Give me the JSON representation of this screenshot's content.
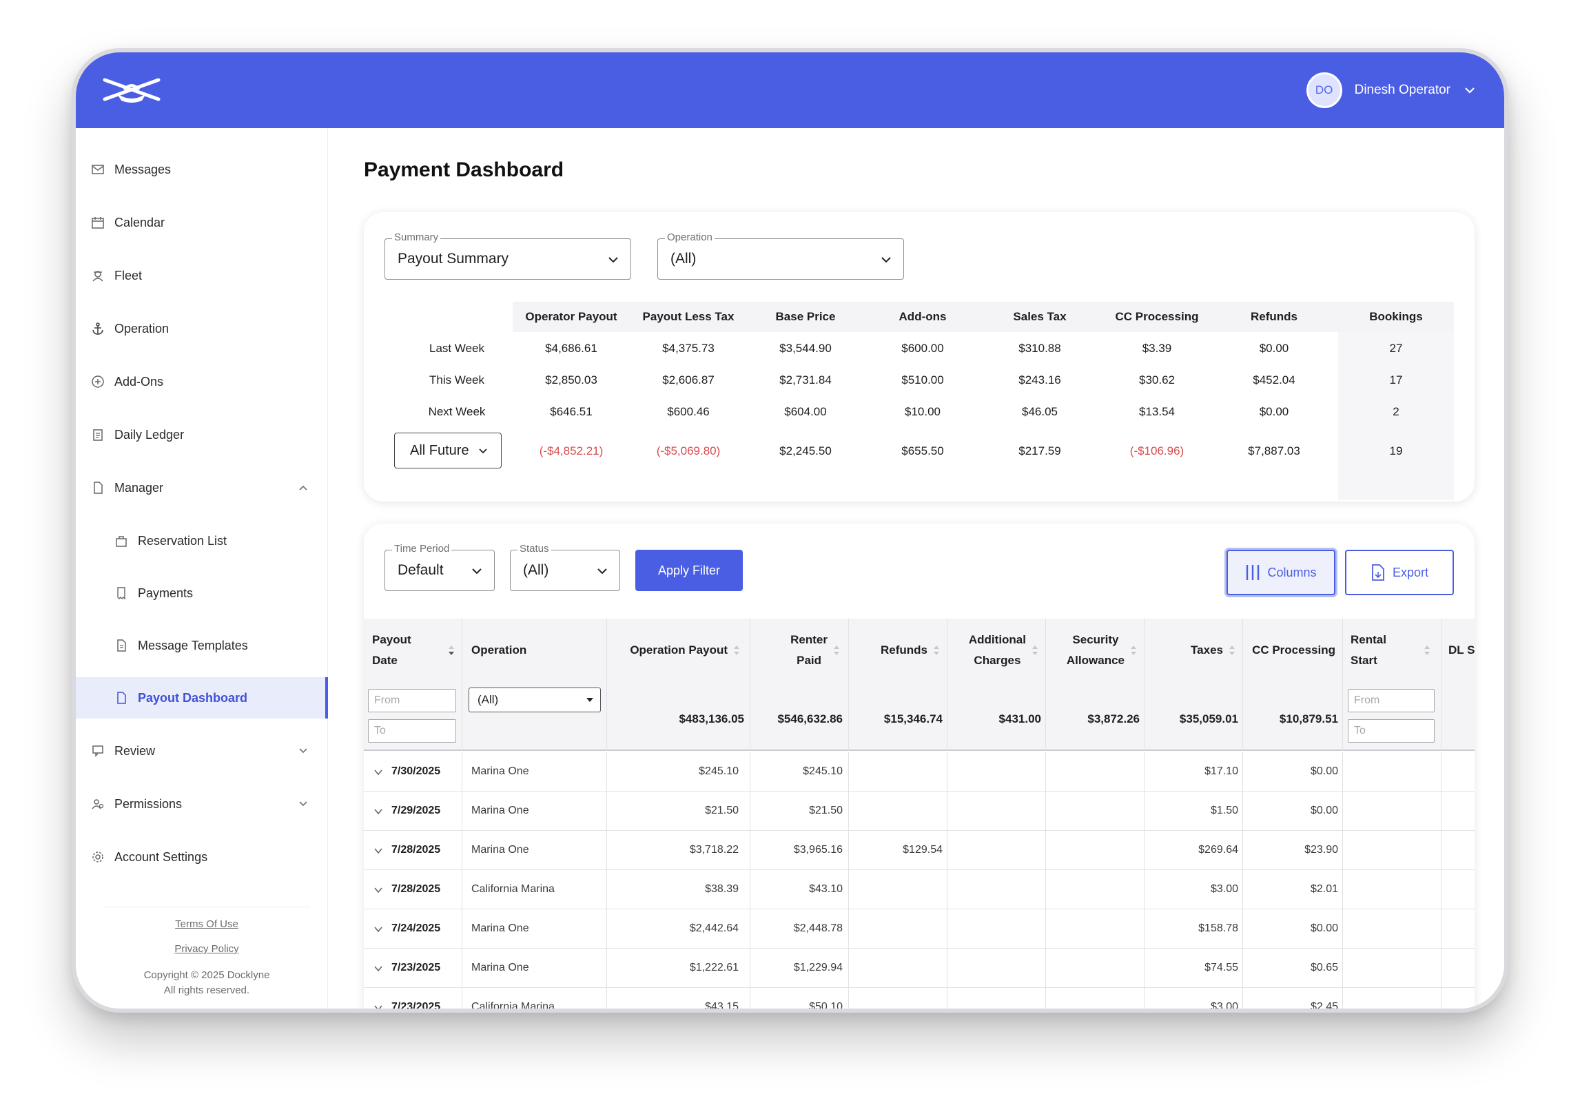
{
  "header": {
    "user_initials": "DO",
    "user_name": "Dinesh Operator"
  },
  "sidebar": {
    "items": [
      {
        "label": "Messages",
        "icon": "mail-icon"
      },
      {
        "label": "Calendar",
        "icon": "calendar-icon"
      },
      {
        "label": "Fleet",
        "icon": "sailor-icon"
      },
      {
        "label": "Operation",
        "icon": "anchor-icon"
      },
      {
        "label": "Add-Ons",
        "icon": "plus-circle-icon"
      },
      {
        "label": "Daily Ledger",
        "icon": "ledger-icon"
      },
      {
        "label": "Manager",
        "icon": "document-icon"
      },
      {
        "label": "Reservation List",
        "icon": "bag-icon"
      },
      {
        "label": "Payments",
        "icon": "receipt-icon"
      },
      {
        "label": "Message Templates",
        "icon": "template-icon"
      },
      {
        "label": "Payout Dashboard",
        "icon": "document-icon"
      },
      {
        "label": "Review",
        "icon": "review-icon"
      },
      {
        "label": "Permissions",
        "icon": "users-icon"
      },
      {
        "label": "Account Settings",
        "icon": "gear-icon"
      }
    ],
    "footer": {
      "terms": "Terms Of Use",
      "privacy": "Privacy Policy",
      "copyright": "Copyright © 2025 Docklyne",
      "rights": "All rights reserved."
    }
  },
  "page": {
    "title": "Payment Dashboard"
  },
  "summary": {
    "summary_label": "Summary",
    "summary_value": "Payout Summary",
    "operation_label": "Operation",
    "operation_value": "(All)",
    "columns": [
      "Operator Payout",
      "Payout Less Tax",
      "Base Price",
      "Add-ons",
      "Sales Tax",
      "CC Processing",
      "Refunds",
      "Bookings"
    ],
    "rows": [
      {
        "label": "Last Week",
        "values": [
          "$4,686.61",
          "$4,375.73",
          "$3,544.90",
          "$600.00",
          "$310.88",
          "$3.39",
          "$0.00",
          "27"
        ]
      },
      {
        "label": "This Week",
        "values": [
          "$2,850.03",
          "$2,606.87",
          "$2,731.84",
          "$510.00",
          "$243.16",
          "$30.62",
          "$452.04",
          "17"
        ]
      },
      {
        "label": "Next Week",
        "values": [
          "$646.51",
          "$600.46",
          "$604.00",
          "$10.00",
          "$46.05",
          "$13.54",
          "$0.00",
          "2"
        ]
      }
    ],
    "future": {
      "label": "All Future",
      "values": [
        "(-$4,852.21)",
        "(-$5,069.80)",
        "$2,245.50",
        "$655.50",
        "$217.59",
        "(-$106.96)",
        "$7,887.03",
        "19"
      ]
    }
  },
  "filters": {
    "time_label": "Time Period",
    "time_value": "Default",
    "status_label": "Status",
    "status_value": "(All)",
    "apply": "Apply Filter",
    "columns": "Columns",
    "export": "Export"
  },
  "table": {
    "headers": {
      "payout_date": [
        "Payout",
        "Date"
      ],
      "operation": "Operation",
      "operation_payout": "Operation Payout",
      "renter_paid": [
        "Renter",
        "Paid"
      ],
      "refunds": "Refunds",
      "additional_charges": [
        "Additional",
        "Charges"
      ],
      "security_allowance": [
        "Security",
        "Allowance"
      ],
      "taxes": "Taxes",
      "cc_processing": "CC Processing",
      "rental_start": [
        "Rental",
        "Start"
      ],
      "dl": "DL S"
    },
    "filter": {
      "from": "From",
      "to": "To",
      "operation": "(All)"
    },
    "totals": {
      "operation_payout": "$483,136.05",
      "renter_paid": "$546,632.86",
      "refunds": "$15,346.74",
      "additional_charges": "$431.00",
      "security_allowance": "$3,872.26",
      "taxes": "$35,059.01",
      "cc_processing": "$10,879.51"
    },
    "rows": [
      {
        "date": "7/30/2025",
        "operation": "Marina One",
        "payout": "$245.10",
        "paid": "$245.10",
        "refunds": "",
        "taxes": "$17.10",
        "cc": "$0.00"
      },
      {
        "date": "7/29/2025",
        "operation": "Marina One",
        "payout": "$21.50",
        "paid": "$21.50",
        "refunds": "",
        "taxes": "$1.50",
        "cc": "$0.00"
      },
      {
        "date": "7/28/2025",
        "operation": "Marina One",
        "payout": "$3,718.22",
        "paid": "$3,965.16",
        "refunds": "$129.54",
        "taxes": "$269.64",
        "cc": "$23.90"
      },
      {
        "date": "7/28/2025",
        "operation": "California Marina",
        "payout": "$38.39",
        "paid": "$43.10",
        "refunds": "",
        "taxes": "$3.00",
        "cc": "$2.01"
      },
      {
        "date": "7/24/2025",
        "operation": "Marina One",
        "payout": "$2,442.64",
        "paid": "$2,448.78",
        "refunds": "",
        "taxes": "$158.78",
        "cc": "$0.00"
      },
      {
        "date": "7/23/2025",
        "operation": "Marina One",
        "payout": "$1,222.61",
        "paid": "$1,229.94",
        "refunds": "",
        "taxes": "$74.55",
        "cc": "$0.65"
      },
      {
        "date": "7/23/2025",
        "operation": "California Marina",
        "payout": "$43.15",
        "paid": "$50.10",
        "refunds": "",
        "taxes": "$3.00",
        "cc": "$2.45"
      }
    ]
  }
}
